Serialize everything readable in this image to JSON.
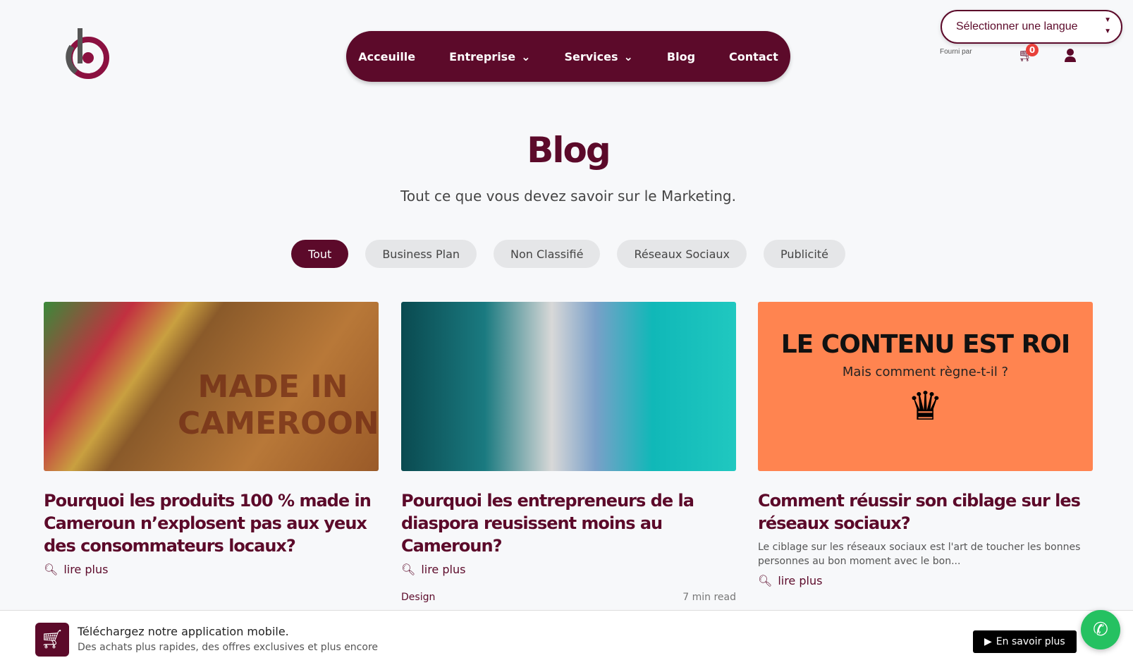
{
  "nav": {
    "items": [
      {
        "label": "Acceuille"
      },
      {
        "label": "Entreprise"
      },
      {
        "label": "Services"
      },
      {
        "label": "Blog"
      },
      {
        "label": "Contact"
      }
    ]
  },
  "language": {
    "selected": "Sélectionner une langue",
    "powered": "Fourni par"
  },
  "cart": {
    "count": "0"
  },
  "header": {
    "title": "Blog",
    "subtitle": "Tout ce que vous devez savoir sur le Marketing."
  },
  "filters": [
    "Tout",
    "Business Plan",
    "Non Classifié",
    "Réseaux Sociaux",
    "Publicité"
  ],
  "posts": [
    {
      "image_text": "MADE IN CAMEROON",
      "title": "Pourquoi les produits 100 % made in Cameroun n’explosent pas aux yeux des consommateurs locaux?",
      "more": "lire plus"
    },
    {
      "title": "Pourquoi les entrepreneurs de la diaspora reusissent moins au Cameroun?",
      "more": "lire plus",
      "category": "Design",
      "read_time": "7 min read"
    },
    {
      "image_title": "LE CONTENU EST ROI",
      "image_sub": "Mais comment règne-t-il ?",
      "title": "Comment réussir son ciblage sur les réseaux sociaux?",
      "excerpt": "Le ciblage sur les réseaux sociaux est l'art de toucher les bonnes personnes au bon moment avec le bon...",
      "more": "lire plus"
    }
  ],
  "app_banner": {
    "title": "Téléchargez notre application mobile.",
    "subtitle": "Des achats plus rapides, des offres exclusives et plus encore",
    "button": "En savoir plus"
  }
}
